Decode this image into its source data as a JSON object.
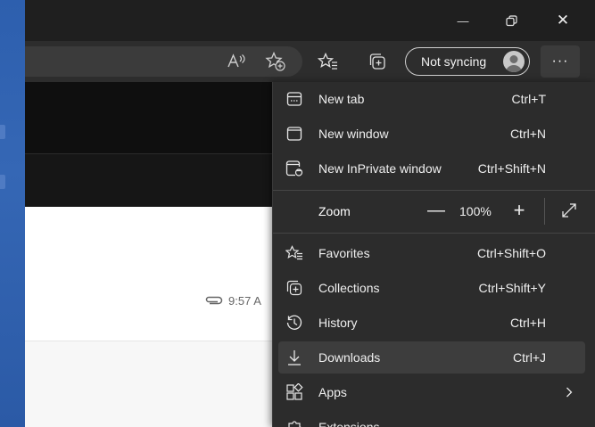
{
  "window": {
    "minimize_glyph": "—",
    "close_glyph": "✕"
  },
  "toolbar": {
    "sync_label": "Not syncing",
    "more_label": "···"
  },
  "page": {
    "timestamp": "9:57 A"
  },
  "menu": {
    "items": [
      {
        "label": "New tab",
        "shortcut": "Ctrl+T",
        "icon": "new-tab-icon"
      },
      {
        "label": "New window",
        "shortcut": "Ctrl+N",
        "icon": "new-window-icon"
      },
      {
        "label": "New InPrivate window",
        "shortcut": "Ctrl+Shift+N",
        "icon": "inprivate-icon"
      },
      {
        "label": "Favorites",
        "shortcut": "Ctrl+Shift+O",
        "icon": "favorites-icon"
      },
      {
        "label": "Collections",
        "shortcut": "Ctrl+Shift+Y",
        "icon": "collections-icon"
      },
      {
        "label": "History",
        "shortcut": "Ctrl+H",
        "icon": "history-icon"
      },
      {
        "label": "Downloads",
        "shortcut": "Ctrl+J",
        "icon": "downloads-icon"
      },
      {
        "label": "Apps",
        "shortcut": "",
        "icon": "apps-icon"
      },
      {
        "label": "Extensions",
        "shortcut": "",
        "icon": "extensions-icon"
      }
    ],
    "zoom": {
      "label": "Zoom",
      "minus": "—",
      "value": "100%",
      "plus": "+"
    },
    "active_item": "Downloads"
  },
  "colors": {
    "menu_bg": "#2c2c2c",
    "hover_bg": "#3d3d3d",
    "titlebar": "#1f1f1f",
    "toolbar": "#2d2d2d",
    "desktop": "#2a5aa8"
  }
}
